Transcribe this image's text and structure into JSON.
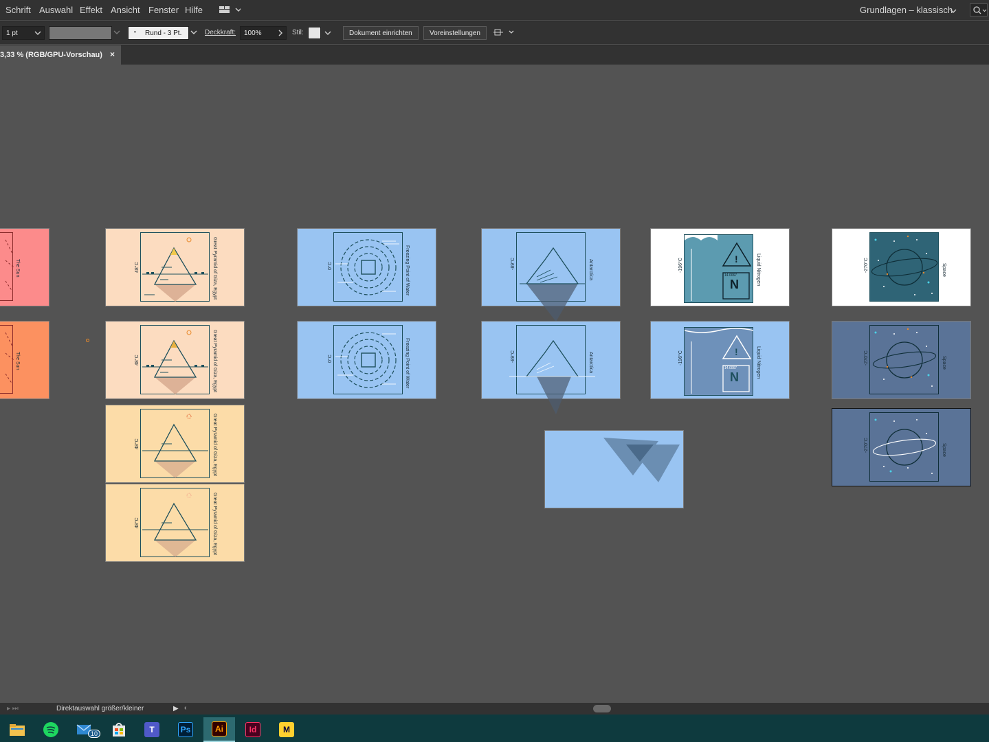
{
  "menu": [
    "Schrift",
    "Auswahl",
    "Effekt",
    "Ansicht",
    "Fenster",
    "Hilfe"
  ],
  "workspace": {
    "label": "Grundlagen – klassisch"
  },
  "control": {
    "stroke_weight": "1 pt",
    "brush": "Rund - 3 Pt.",
    "opacity_label": "Deckkraft:",
    "opacity_value": "100%",
    "style_label": "Stil:",
    "doc_setup": "Dokument einrichten",
    "prefs": "Voreinstellungen"
  },
  "document": {
    "tab_title": "3,33 % (RGB/GPU-Vorschau)",
    "close": "×"
  },
  "artboards": {
    "sun_label": "The Sun",
    "pyramid_label": "Great Pyramid of Giza, Egypt",
    "pyramid_temp": "48°C",
    "freeze_label": "Freezing Point of Water",
    "freeze_temp": "0°C",
    "antarctica_label": "Antarctica",
    "antarctica_temp": "-89°C",
    "nitrogen_label": "Liquid Nitrogen",
    "nitrogen_temp": "-196°C",
    "nitrogen_symbol": "N",
    "nitrogen_number": "14.0067",
    "space_label": "Space",
    "space_temp": "-270°C"
  },
  "status": {
    "text": "Direktauswahl größer/kleiner"
  },
  "taskbar": {
    "mail_badge": "10",
    "apps": [
      {
        "name": "file-explorer",
        "glyph": ""
      },
      {
        "name": "spotify",
        "glyph": ""
      },
      {
        "name": "mail",
        "glyph": ""
      },
      {
        "name": "store",
        "glyph": ""
      },
      {
        "name": "teams",
        "glyph": "T"
      },
      {
        "name": "photoshop",
        "glyph": "Ps"
      },
      {
        "name": "illustrator",
        "glyph": "Ai"
      },
      {
        "name": "indesign",
        "glyph": "Id"
      },
      {
        "name": "miro",
        "glyph": "M"
      }
    ]
  },
  "colors": {
    "sun1": "#fc8b8b",
    "sun2": "#fc9160",
    "peach": "#fcdcc0",
    "sand": "#fcdca8",
    "lightblue": "#99c4f2",
    "teal": "#5c9bb0",
    "darkteal": "#2f6476",
    "slate": "#5a7397",
    "accent_orange": "#e98a2b"
  }
}
